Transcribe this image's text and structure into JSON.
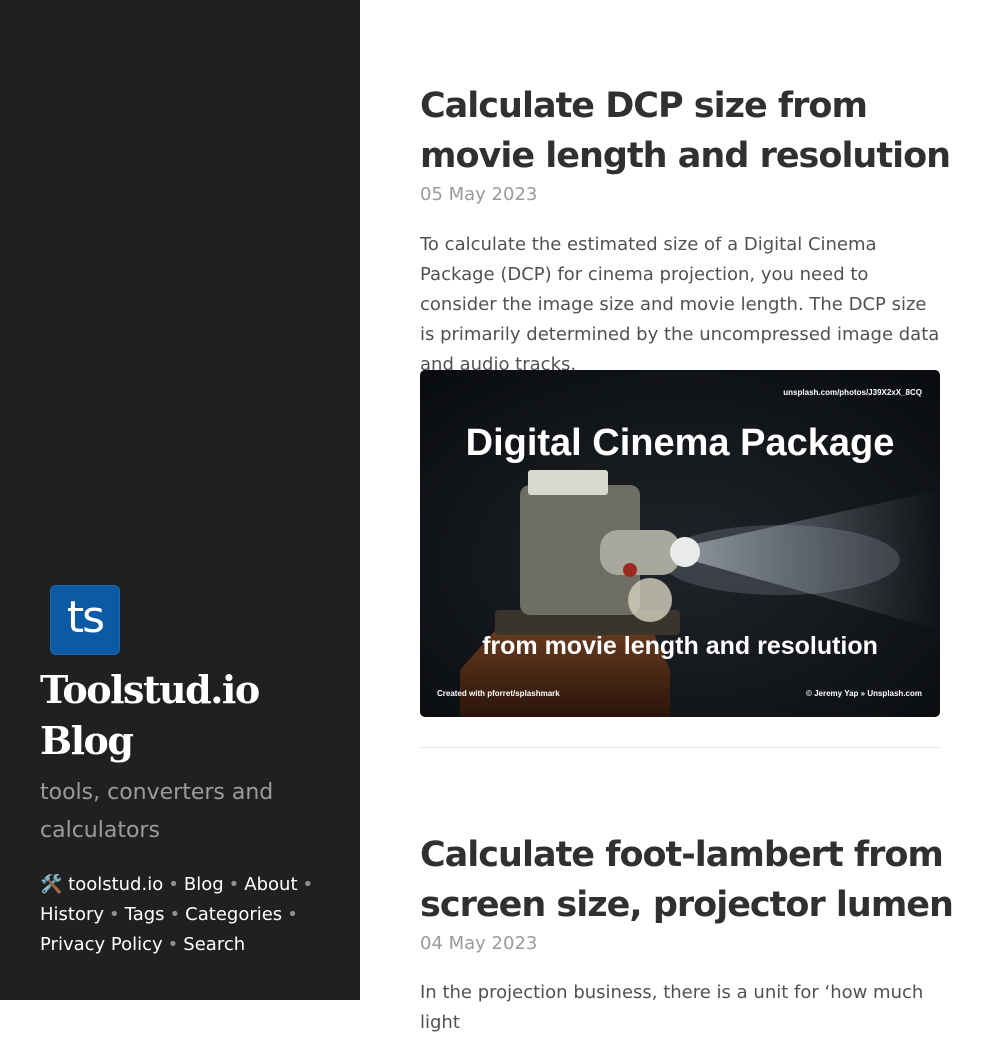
{
  "sidebar": {
    "logo_text": "ts",
    "title": "Toolstud.io Blog",
    "tagline": "tools, converters and calculators",
    "nav": [
      {
        "label": "🛠️ toolstud.io"
      },
      {
        "label": "Blog"
      },
      {
        "label": "About"
      },
      {
        "label": "History"
      },
      {
        "label": "Tags"
      },
      {
        "label": "Categories"
      },
      {
        "label": "Privacy Policy"
      },
      {
        "label": "Search"
      }
    ]
  },
  "posts": [
    {
      "title": "Calculate DCP size from movie length and resolution",
      "date": "05 May 2023",
      "excerpt": "To calculate the estimated size of a Digital Cinema Package (DCP) for cinema projection, you need to consider the image size and movie length. The DCP size is primarily determined by the uncompressed image data and audio tracks.",
      "image": {
        "source_url": "unsplash.com/photos/J39X2xX_8CQ",
        "heading": "Digital Cinema Package",
        "subheading": "from movie length and resolution",
        "credit_left": "Created with pforret/splashmark",
        "credit_right": "© Jeremy Yap » Unsplash.com"
      }
    },
    {
      "title": "Calculate foot-lambert from screen size, projector lumen",
      "date": "04 May 2023",
      "excerpt": "In the projection business, there is a unit for ‘how much light"
    }
  ],
  "colors": {
    "sidebar_bg": "#202020",
    "logo_bg": "#0c5aa6",
    "title_text": "#303030",
    "muted_text": "#9a9a9a"
  }
}
